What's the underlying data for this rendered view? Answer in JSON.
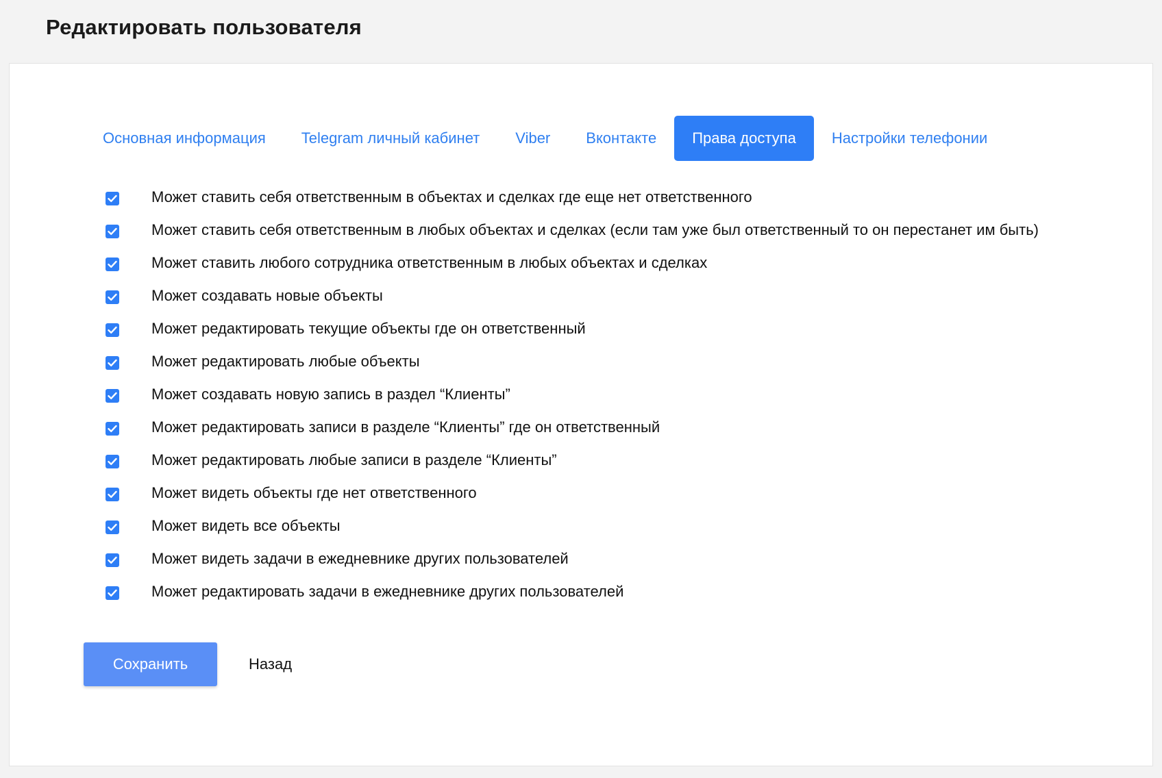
{
  "header": {
    "title": "Редактировать пользователя"
  },
  "tabs": [
    {
      "label": "Основная информация",
      "active": false
    },
    {
      "label": "Telegram личный кабинет",
      "active": false
    },
    {
      "label": "Viber",
      "active": false
    },
    {
      "label": "Вконтакте",
      "active": false
    },
    {
      "label": "Права доступа",
      "active": true
    },
    {
      "label": "Настройки телефонии",
      "active": false
    }
  ],
  "permissions": [
    {
      "label": "Может ставить себя ответственным в объектах и сделках где еще нет ответственного",
      "checked": true
    },
    {
      "label": "Может ставить себя ответственным в любых объектах и сделках (если там уже был ответственный то он перестанет им быть)",
      "checked": true
    },
    {
      "label": "Может ставить любого сотрудника ответственным в любых объектах и сделках",
      "checked": true
    },
    {
      "label": "Может создавать новые объекты",
      "checked": true
    },
    {
      "label": "Может редактировать текущие объекты где он ответственный",
      "checked": true
    },
    {
      "label": "Может редактировать любые объекты",
      "checked": true
    },
    {
      "label": "Может создавать новую запись в раздел “Клиенты”",
      "checked": true
    },
    {
      "label": "Может редактировать записи в разделе “Клиенты” где он ответственный",
      "checked": true
    },
    {
      "label": "Может редактировать любые записи в разделе “Клиенты”",
      "checked": true
    },
    {
      "label": "Может видеть объекты где нет ответственного",
      "checked": true
    },
    {
      "label": "Может видеть все объекты",
      "checked": true
    },
    {
      "label": "Может видеть задачи в ежедневнике других пользователей",
      "checked": true
    },
    {
      "label": "Может редактировать задачи в ежедневнике других пользователей",
      "checked": true
    }
  ],
  "actions": {
    "save_label": "Сохранить",
    "back_label": "Назад"
  },
  "colors": {
    "accent": "#2e7ef6",
    "tab_text": "#2f7ff0",
    "save_button": "#5a8ff6",
    "page_bg": "#f3f3f3"
  },
  "icons": {
    "checkbox": "checkmark-icon"
  }
}
